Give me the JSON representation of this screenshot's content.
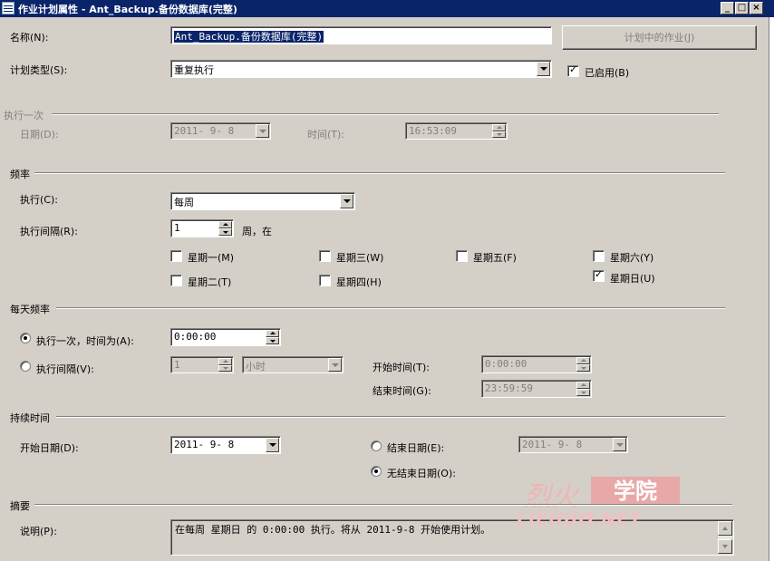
{
  "window": {
    "title": "作业计划属性 - Ant_Backup.备份数据库(完整)"
  },
  "name": {
    "label": "名称(N):",
    "value": "Ant_Backup.备份数据库(完整)"
  },
  "jobs_in_schedule_button": "计划中的作业(J)",
  "schedule_type": {
    "label": "计划类型(S):",
    "value": "重复执行"
  },
  "enabled": {
    "label": "已启用(B)",
    "checked": true
  },
  "one_time": {
    "section": "执行一次",
    "date_label": "日期(D):",
    "date_value": "2011- 9- 8",
    "time_label": "时间(T):",
    "time_value": "16:53:09"
  },
  "frequency": {
    "section": "频率",
    "occurs_label": "执行(C):",
    "occurs_value": "每周",
    "recur_label": "执行间隔(R):",
    "recur_value": "1",
    "recur_unit": "周，在",
    "days": [
      {
        "label": "星期一(M)",
        "checked": false
      },
      {
        "label": "星期三(W)",
        "checked": false
      },
      {
        "label": "星期五(F)",
        "checked": false
      },
      {
        "label": "星期六(Y)",
        "checked": false
      },
      {
        "label": "星期二(T)",
        "checked": false
      },
      {
        "label": "星期四(H)",
        "checked": false
      },
      {
        "label": "星期日(U)",
        "checked": true
      }
    ]
  },
  "daily": {
    "section": "每天频率",
    "once_label": "执行一次，时间为(A):",
    "once_value": "0:00:00",
    "once_selected": true,
    "every_label": "执行间隔(V):",
    "every_value": "1",
    "every_unit": "小时",
    "start_label": "开始时间(T):",
    "start_value": "0:00:00",
    "end_label": "结束时间(G):",
    "end_value": "23:59:59"
  },
  "duration": {
    "section": "持续时间",
    "start_label": "开始日期(D):",
    "start_value": "2011- 9- 8",
    "end_label": "结束日期(E):",
    "end_value": "2011- 9- 8",
    "no_end_label": "无结束日期(O):",
    "no_end_selected": true
  },
  "summary": {
    "section": "摘要",
    "desc_label": "说明(P):",
    "desc_value": "在每周 星期日 的 0:00:00 执行。将从 2011-9-8 开始使用计划。"
  },
  "watermark": {
    "cn1": "烈火",
    "cn2": "学院",
    "en": "LIEHUO.NET"
  }
}
